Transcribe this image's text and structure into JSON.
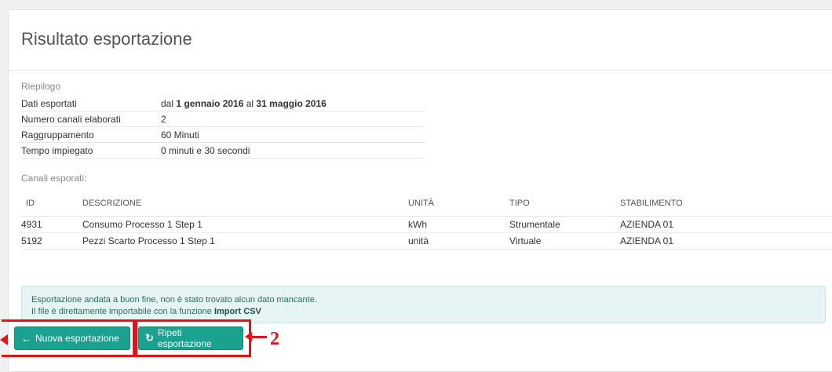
{
  "page": {
    "title": "Risultato esportazione"
  },
  "summary": {
    "label": "Riepilogo",
    "rows": [
      {
        "key": "Dati esportati",
        "pre": "dal ",
        "from": "1 gennaio 2016",
        "mid": " al ",
        "to": "31 maggio 2016"
      },
      {
        "key": "Numero canali elaborati",
        "value": "2"
      },
      {
        "key": "Raggruppamento",
        "value": "60 Minuti"
      },
      {
        "key": "Tempo impiegato",
        "value": "0 minuti e 30 secondi"
      }
    ]
  },
  "channels": {
    "label": "Canali esporati:",
    "headers": {
      "id": "ID",
      "desc": "DESCRIZIONE",
      "unit": "UNITÀ",
      "type": "TIPO",
      "stab": "STABILIMENTO"
    },
    "rows": [
      {
        "id": "4931",
        "desc": "Consumo Processo 1 Step 1",
        "unit": "kWh",
        "type": "Strumentale",
        "stab": "AZIENDA 01"
      },
      {
        "id": "5192",
        "desc": "Pezzi Scarto Processo 1 Step 1",
        "unit": "unità",
        "type": "Virtuale",
        "stab": "AZIENDA 01"
      }
    ]
  },
  "alert": {
    "line1": "Esportazione andata a buon fine, non è stato trovato alcun dato mancante.",
    "line2_pre": "Il file è direttamente importabile con la funzione ",
    "line2_link": "Import CSV"
  },
  "buttons": {
    "new_label": "Nuova esportazione",
    "new_icon": "arrow-left-icon",
    "repeat_label": "Ripeti esportazione",
    "repeat_icon": "refresh-icon"
  },
  "annotation": {
    "step": "2",
    "color": "#e8101b"
  },
  "colors": {
    "accent": "#1aa190",
    "alert_bg": "#e6f4f3"
  }
}
